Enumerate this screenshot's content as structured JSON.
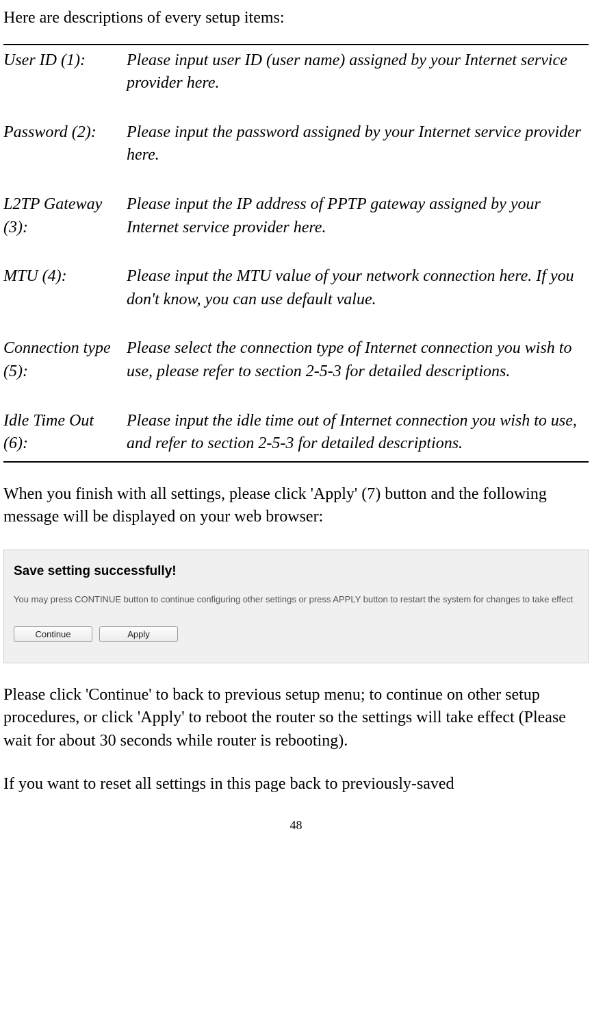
{
  "intro": "Here are descriptions of every setup items:",
  "definitions": [
    {
      "term": "User ID (1):",
      "desc": "Please input user ID (user name) assigned by your Internet service provider here."
    },
    {
      "term": "Password (2):",
      "desc": "Please input the password assigned by your Internet service provider here."
    },
    {
      "term": "L2TP Gateway (3):",
      "desc": "Please input the IP address of PPTP gateway assigned by your Internet service provider here."
    },
    {
      "term": "MTU (4):",
      "desc": "Please input the MTU value of your network connection here. If you don't know, you can use default value."
    },
    {
      "term": "Connection type (5):",
      "desc": "Please select the connection type of Internet connection you wish to use, please refer to section 2-5-3 for detailed descriptions."
    },
    {
      "term": "Idle Time Out (6):",
      "desc": "Please input the idle time out of Internet connection you wish to use, and refer to section 2-5-3 for detailed descriptions."
    }
  ],
  "para1": "When you finish with all settings, please click 'Apply' (7) button and the following message will be displayed on your web browser:",
  "dialog": {
    "title": "Save setting successfully!",
    "text": "You may press CONTINUE button to continue configuring other settings or press APPLY button to restart the system for changes to take effect",
    "continue": "Continue",
    "apply": "Apply"
  },
  "para2": "Please click 'Continue' to back to previous setup menu; to continue on other setup procedures, or click 'Apply' to reboot the router so the settings will take effect (Please wait for about 30 seconds while router is rebooting).",
  "para3": "If you want to reset all settings in this page back to previously-saved",
  "page_number": "48"
}
